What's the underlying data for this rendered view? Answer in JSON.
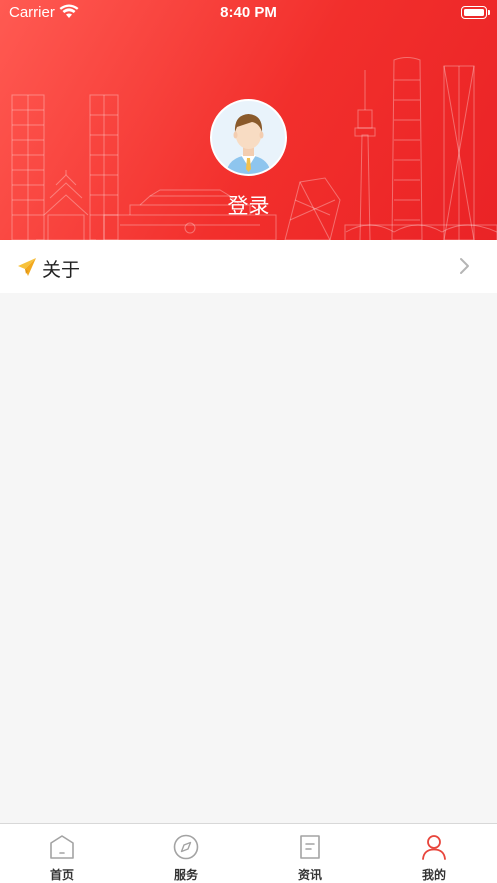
{
  "status_bar": {
    "carrier": "Carrier",
    "time": "8:40 PM"
  },
  "header": {
    "login_label": "登录",
    "gradient_colors": [
      "#ff5a52",
      "#ea2326"
    ]
  },
  "menu": {
    "about_label": "关于",
    "about_icon": "paper-plane-icon"
  },
  "tabbar": {
    "active_color": "#e8453c",
    "inactive_color": "#999999",
    "tabs": [
      {
        "label": "首页",
        "icon": "home-icon"
      },
      {
        "label": "服务",
        "icon": "compass-icon"
      },
      {
        "label": "资讯",
        "icon": "document-icon"
      },
      {
        "label": "我的",
        "icon": "person-icon",
        "active": true
      }
    ]
  }
}
